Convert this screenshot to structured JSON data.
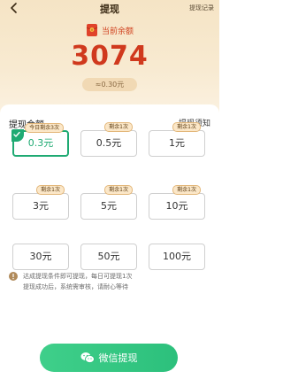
{
  "nav": {
    "title": "提现",
    "history_label": "提现记录"
  },
  "balance": {
    "label": "当前余额",
    "value": "3074",
    "equivalent": "≈0.30元"
  },
  "amounts": {
    "title": "提现金额",
    "notice_label": "提现须知",
    "options": [
      {
        "label": "0.3元",
        "badge": "今日剩余3次",
        "selected": true
      },
      {
        "label": "0.5元",
        "badge": "剩余1次"
      },
      {
        "label": "1元",
        "badge": "剩余1次"
      },
      {
        "label": "3元",
        "badge": "剩余1次"
      },
      {
        "label": "5元",
        "badge": "剩余1次"
      },
      {
        "label": "10元",
        "badge": "剩余1次"
      },
      {
        "label": "30元",
        "badge": ""
      },
      {
        "label": "50元",
        "badge": ""
      },
      {
        "label": "100元",
        "badge": ""
      }
    ]
  },
  "info": {
    "line1": "达成提现条件即可提现，每日可提现1次",
    "line2": "提现成功后，系统需审核，请耐心等待"
  },
  "withdraw_button": {
    "label": "微信提现"
  },
  "colors": {
    "accent_red": "#d0391d",
    "accent_green": "#1faa73",
    "header_bg": "#f5e4c5"
  }
}
